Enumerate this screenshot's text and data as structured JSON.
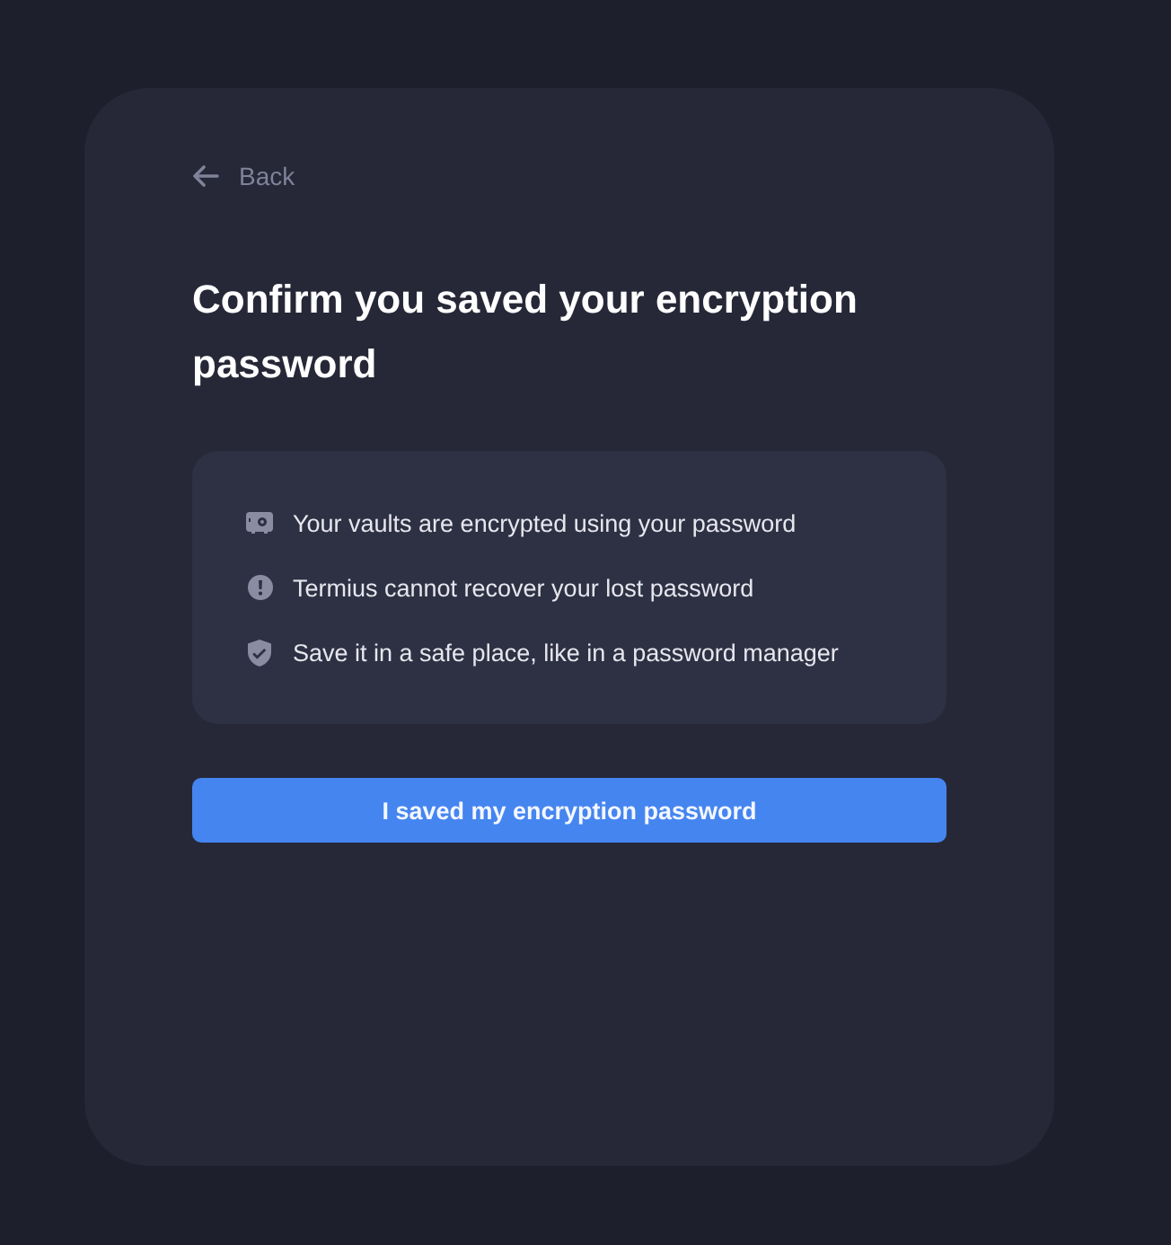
{
  "back": {
    "label": "Back"
  },
  "title": "Confirm you saved your encryption password",
  "notes": [
    {
      "kind": "vault",
      "text": "Your vaults are encrypted using your password"
    },
    {
      "kind": "warning",
      "text": "Termius cannot recover your lost password"
    },
    {
      "kind": "shield",
      "text": "Save it in a safe place, like in a password manager"
    }
  ],
  "confirm_button": {
    "label": "I saved my encryption password"
  }
}
